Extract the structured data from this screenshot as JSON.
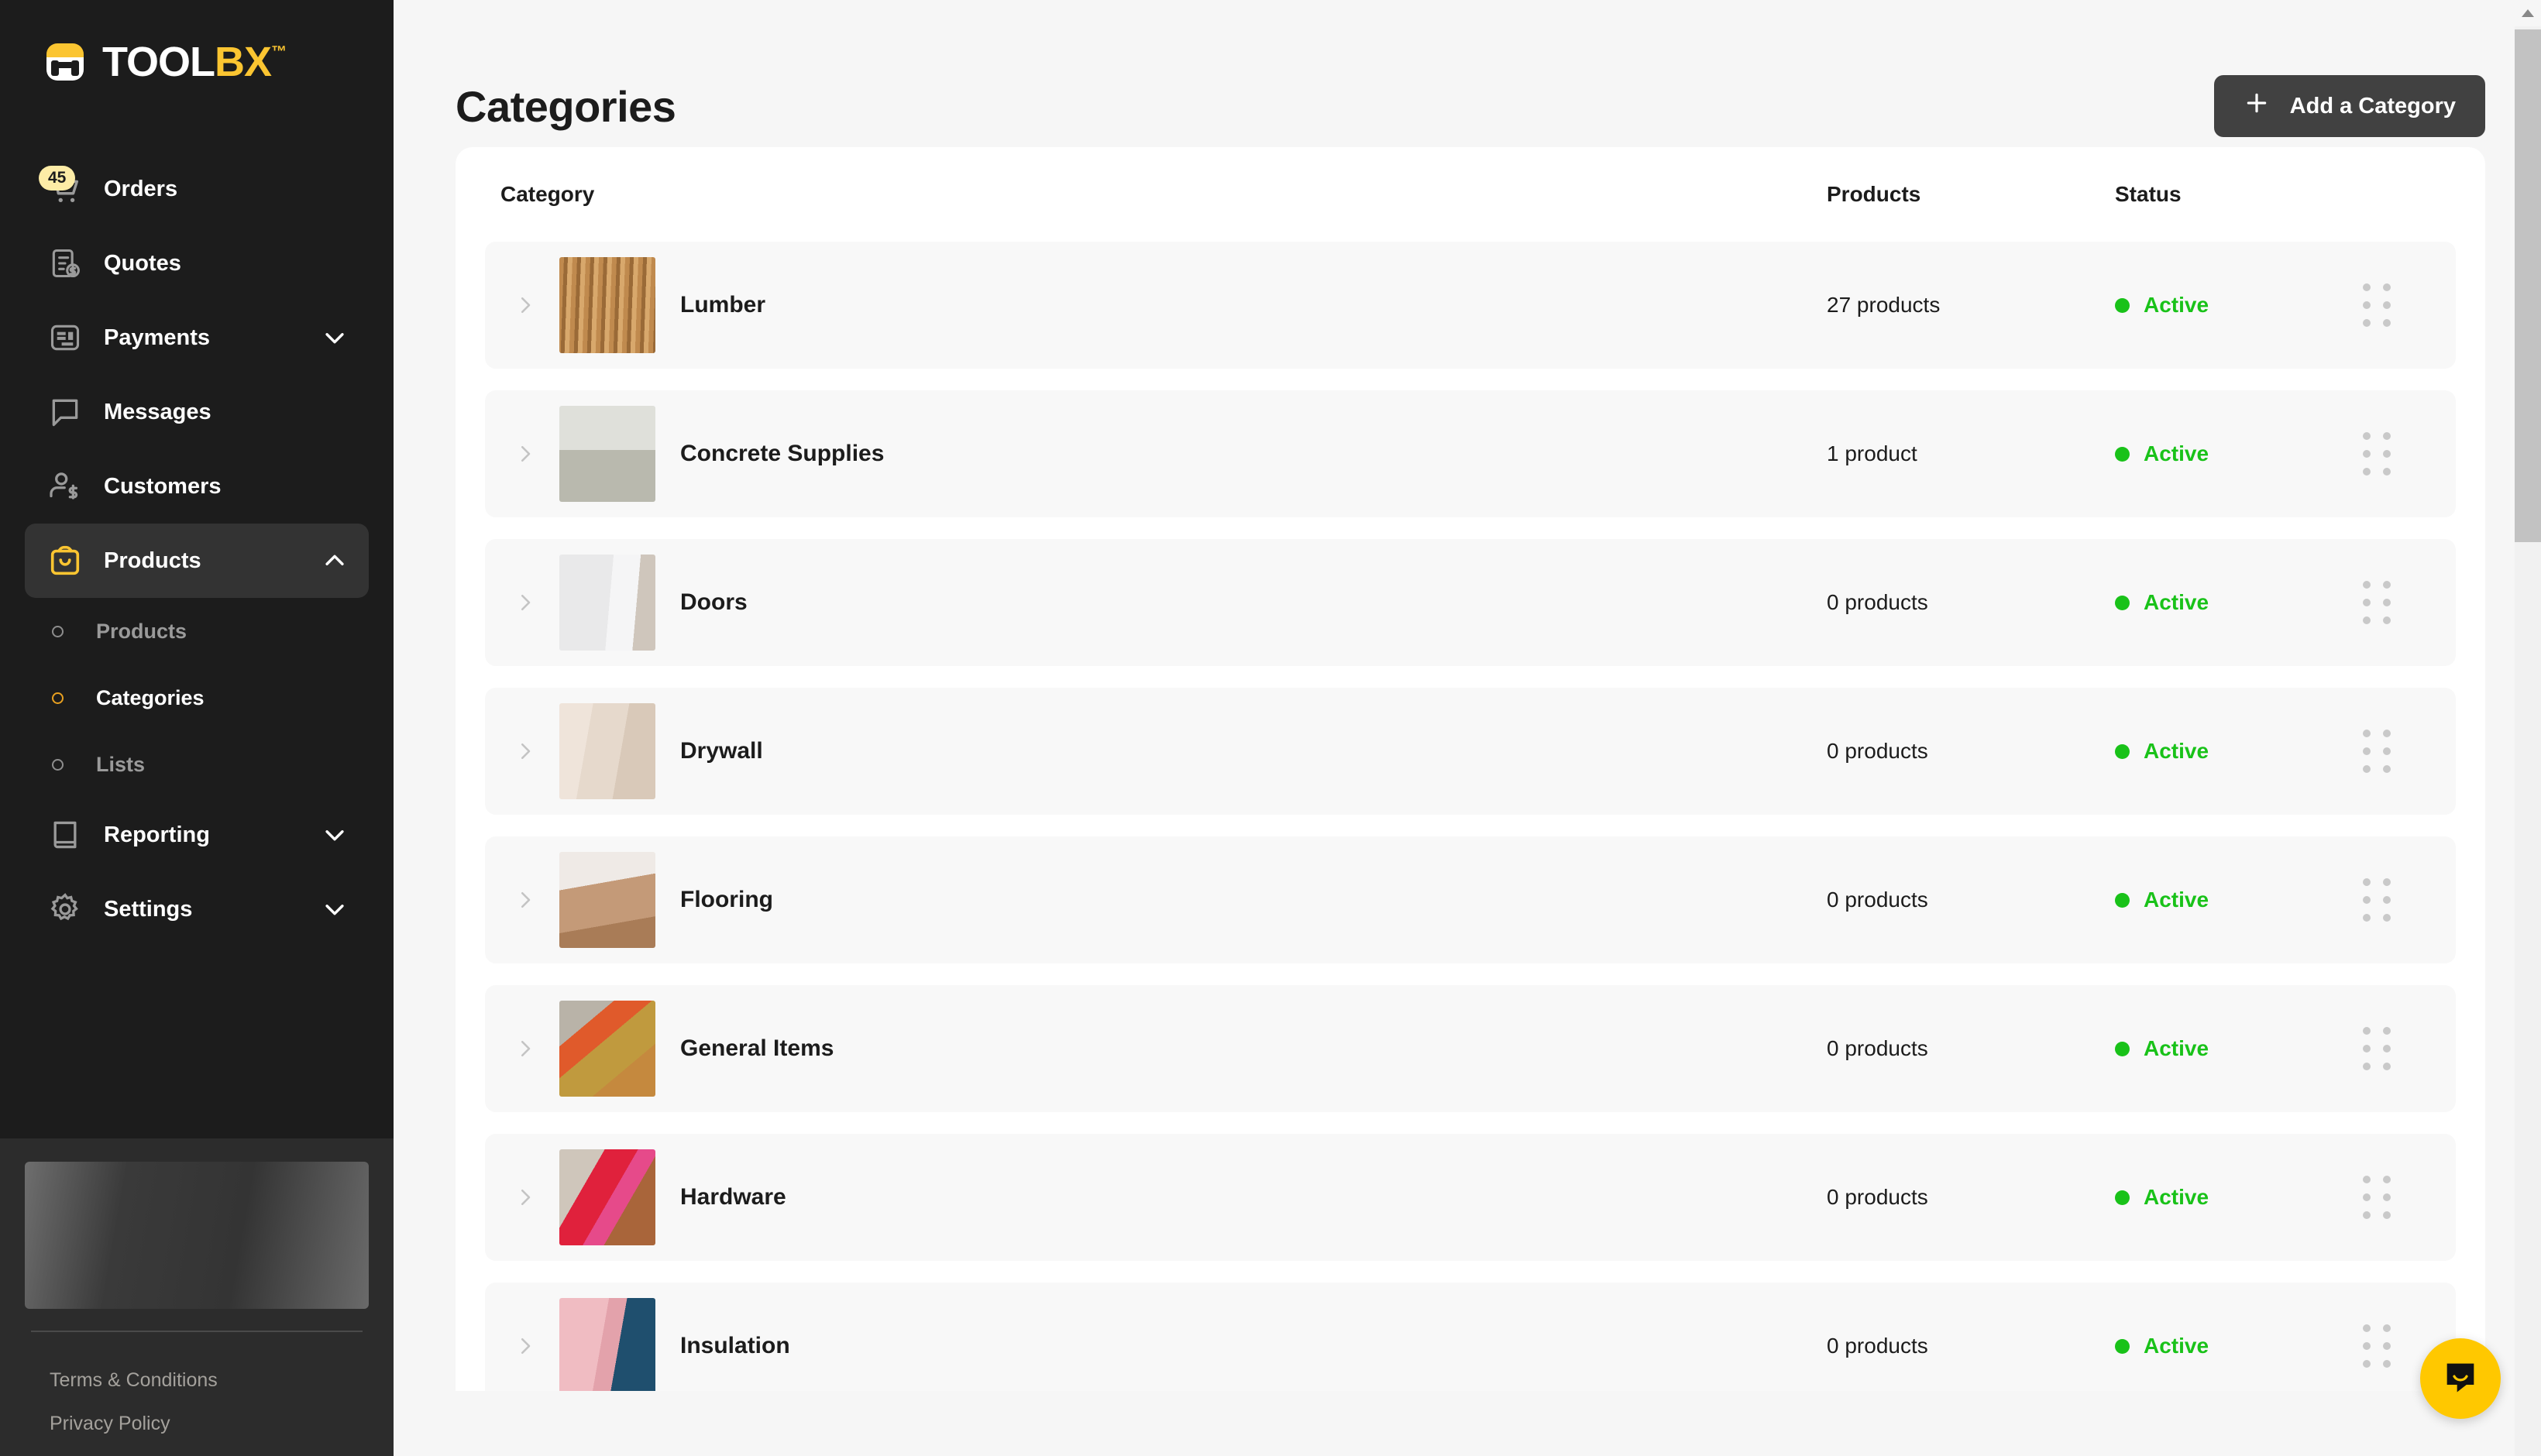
{
  "brand": {
    "name_white": "TOOL",
    "name_yellow": "BX",
    "trademark": "™",
    "logo_icon": "toolbx-logo-icon",
    "accent_yellow": "#fbc531",
    "sidebar_bg": "#1c1c1c"
  },
  "sidebar": {
    "items": [
      {
        "label": "Orders",
        "icon": "shopping-cart-icon",
        "badge": "45",
        "caret": "",
        "active": false
      },
      {
        "label": "Quotes",
        "icon": "quote-clipboard-icon",
        "badge": "",
        "caret": "",
        "active": false
      },
      {
        "label": "Payments",
        "icon": "payments-card-icon",
        "badge": "",
        "caret": "chevron-down-icon",
        "active": false
      },
      {
        "label": "Messages",
        "icon": "message-bubble-icon",
        "badge": "",
        "caret": "",
        "active": false
      },
      {
        "label": "Customers",
        "icon": "customer-dollar-icon",
        "badge": "",
        "caret": "",
        "active": false
      },
      {
        "label": "Products",
        "icon": "products-bag-icon",
        "badge": "",
        "caret": "chevron-up-icon",
        "active": true
      }
    ],
    "sub_items": [
      {
        "label": "Products",
        "current": false
      },
      {
        "label": "Categories",
        "current": true
      },
      {
        "label": "Lists",
        "current": false
      }
    ],
    "items_after": [
      {
        "label": "Reporting",
        "icon": "reporting-book-icon",
        "caret": "chevron-down-icon"
      },
      {
        "label": "Settings",
        "icon": "settings-gear-icon",
        "caret": "chevron-down-icon"
      }
    ],
    "footer": {
      "terms_label": "Terms & Conditions",
      "privacy_label": "Privacy Policy"
    }
  },
  "header": {
    "title": "Categories",
    "add_button_label": "Add a Category",
    "add_button_icon": "plus-icon"
  },
  "table": {
    "columns": {
      "category": "Category",
      "products": "Products",
      "status": "Status"
    },
    "rows": [
      {
        "name": "Lumber",
        "products": "27 products",
        "status": "Active",
        "thumb": "lumber-thumbnail",
        "thumb_class": "t-lumber"
      },
      {
        "name": "Concrete Supplies",
        "products": "1 product",
        "status": "Active",
        "thumb": "concrete-thumbnail",
        "thumb_class": "t-concrete"
      },
      {
        "name": "Doors",
        "products": "0 products",
        "status": "Active",
        "thumb": "doors-thumbnail",
        "thumb_class": "t-doors"
      },
      {
        "name": "Drywall",
        "products": "0 products",
        "status": "Active",
        "thumb": "drywall-thumbnail",
        "thumb_class": "t-drywall"
      },
      {
        "name": "Flooring",
        "products": "0 products",
        "status": "Active",
        "thumb": "flooring-thumbnail",
        "thumb_class": "t-flooring"
      },
      {
        "name": "General Items",
        "products": "0 products",
        "status": "Active",
        "thumb": "general-thumbnail",
        "thumb_class": "t-general"
      },
      {
        "name": "Hardware",
        "products": "0 products",
        "status": "Active",
        "thumb": "hardware-thumbnail",
        "thumb_class": "t-hardware"
      },
      {
        "name": "Insulation",
        "products": "0 products",
        "status": "Active",
        "thumb": "insulation-thumbnail",
        "thumb_class": "t-insulation"
      }
    ],
    "status_color": "#19c219",
    "expand_icon": "chevron-right-icon",
    "drag_icon": "drag-handle-icon"
  },
  "widgets": {
    "intercom_icon": "intercom-chat-icon",
    "intercom_color": "#ffc800",
    "scroll_up_icon": "scroll-up-arrow-icon"
  }
}
